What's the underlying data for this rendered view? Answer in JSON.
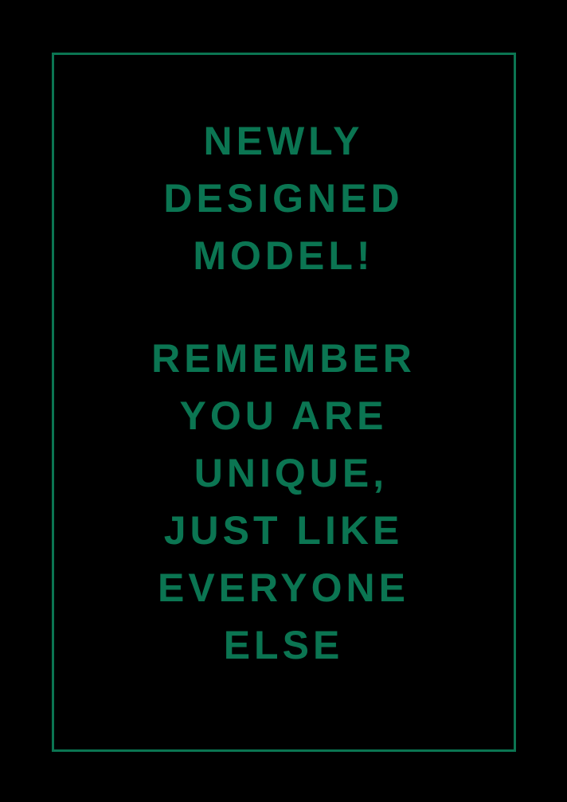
{
  "poster": {
    "colors": {
      "background": "#000000",
      "frame": "#0b7552",
      "text": "#0b7552"
    },
    "headline_lines": [
      "NEWLY",
      "DESIGNED",
      "MODEL!"
    ],
    "message_lines": [
      "REMEMBER",
      "YOU ARE",
      " UNIQUE,",
      "JUST LIKE",
      "EVERYONE",
      "ELSE"
    ]
  }
}
